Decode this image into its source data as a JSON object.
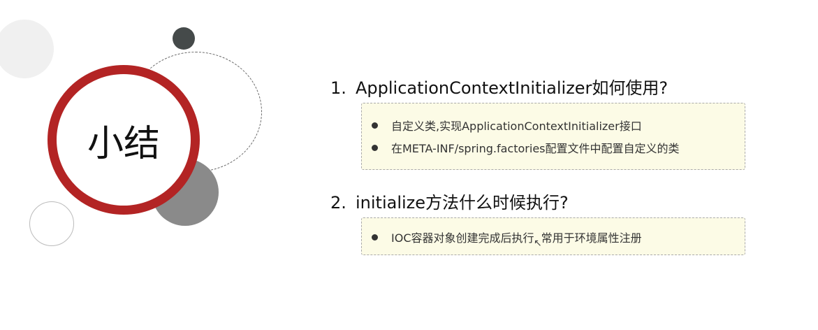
{
  "title": "小结",
  "sections": [
    {
      "number": "1.",
      "heading": "ApplicationContextInitializer如何使用?",
      "bullets": [
        "自定义类,实现ApplicationContextInitializer接口",
        "在META-INF/spring.factories配置文件中配置自定义的类"
      ]
    },
    {
      "number": "2.",
      "heading": "initialize方法什么时候执行?",
      "bullets": [
        "IOC容器对象创建完成后执行, 常用于环境属性注册"
      ]
    }
  ],
  "colors": {
    "ring": "#b32424",
    "box_bg": "#fcfbe6"
  }
}
